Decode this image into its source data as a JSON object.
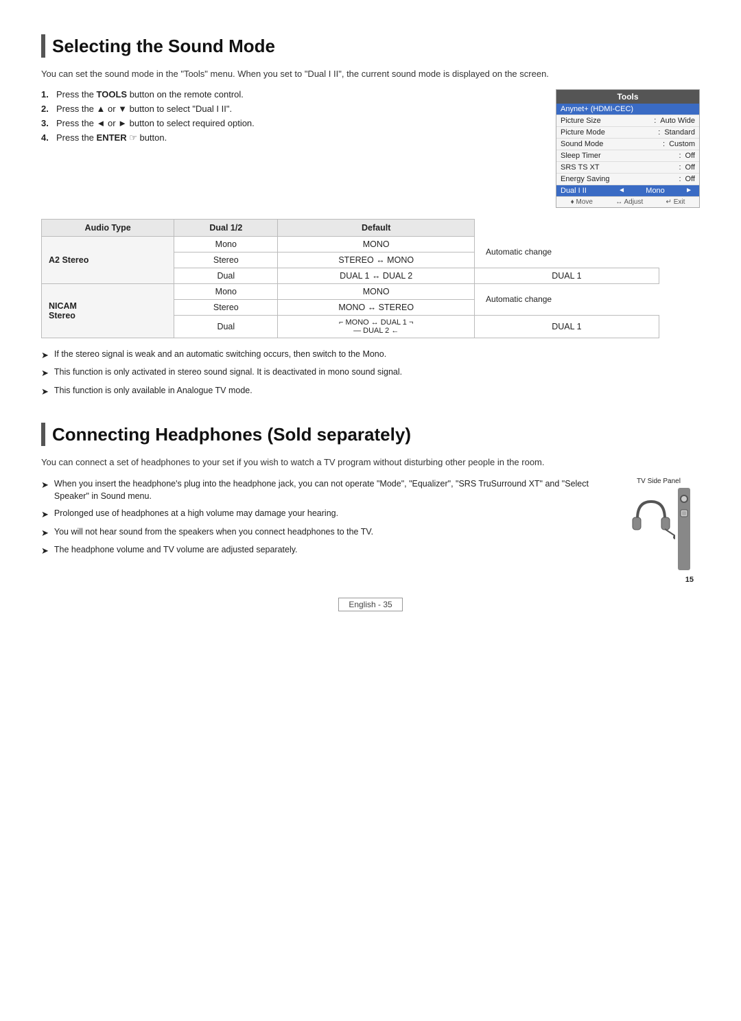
{
  "section1": {
    "title": "Selecting the Sound Mode",
    "intro": "You can set the sound mode in the \"Tools\" menu. When you set to \"Dual I II\", the current sound mode is displayed on the screen.",
    "steps": [
      {
        "num": "1.",
        "text": "Press the ",
        "bold": "TOOLS",
        "rest": " button on the remote control."
      },
      {
        "num": "2.",
        "text": "Press the ▲ or ▼ button to select \"Dual I II\"."
      },
      {
        "num": "3.",
        "text": "Press the ◄ or ► button to select required option."
      },
      {
        "num": "4.",
        "text": "Press the ",
        "bold": "ENTER",
        "rest": " ☞ button."
      }
    ],
    "tools_menu": {
      "title": "Tools",
      "rows": [
        {
          "label": "Anynet+ (HDMI-CEC)",
          "value": "",
          "highlighted": true
        },
        {
          "label": "Picture Size",
          "colon": ":",
          "value": "Auto Wide"
        },
        {
          "label": "Picture Mode",
          "colon": ":",
          "value": "Standard"
        },
        {
          "label": "Sound Mode",
          "colon": ":",
          "value": "Custom"
        },
        {
          "label": "Sleep Timer",
          "colon": ":",
          "value": "Off"
        },
        {
          "label": "SRS TS XT",
          "colon": ":",
          "value": "Off"
        },
        {
          "label": "Energy Saving",
          "colon": ":",
          "value": "Off"
        }
      ],
      "nav_row": {
        "label": "Dual I II",
        "left_arrow": "◄",
        "value": "Mono",
        "right_arrow": "►"
      },
      "footer": [
        "♦ Move",
        "↔ Adjust",
        "↵ Exit"
      ]
    },
    "table": {
      "headers": [
        "Audio Type",
        "Dual 1/2",
        "Default"
      ],
      "groups": [
        {
          "type": "A2 Stereo",
          "rows": [
            {
              "audio": "Mono",
              "dual": "MONO",
              "default": "",
              "note": ""
            },
            {
              "audio": "Stereo",
              "dual": "STEREO ↔ MONO",
              "default": "",
              "note": "Automatic change"
            },
            {
              "audio": "Dual",
              "dual": "DUAL 1 ↔ DUAL 2",
              "default": "DUAL 1",
              "note": ""
            }
          ]
        },
        {
          "type": "NICAM Stereo",
          "rows": [
            {
              "audio": "Mono",
              "dual": "MONO",
              "default": "",
              "note": ""
            },
            {
              "audio": "Stereo",
              "dual": "MONO ↔ STEREO",
              "default": "",
              "note": "Automatic change"
            },
            {
              "audio": "Dual",
              "dual": "⌐ MONO ↔ DUAL 1 ¬\n— DUAL 2 ←",
              "default": "DUAL 1",
              "note": ""
            }
          ]
        }
      ]
    },
    "notes": [
      "If the stereo signal is weak and an automatic switching occurs, then switch to the Mono.",
      "This function is only activated in stereo sound signal. It is deactivated in mono sound signal.",
      "This function is only available in Analogue TV mode."
    ]
  },
  "section2": {
    "title": "Connecting Headphones (Sold separately)",
    "intro": "You can connect a set of headphones to your set if you wish to watch a TV program without disturbing other people in the room.",
    "bullets": [
      "When you insert the headphone's plug into the headphone jack, you can not operate \"Mode\", \"Equalizer\", \"SRS TruSurround XT\" and \"Select Speaker\" in Sound menu.",
      "Prolonged use of headphones at a high volume may damage your hearing.",
      "You will not hear sound from the speakers when you connect headphones to the TV.",
      "The headphone volume and TV volume are adjusted separately."
    ],
    "tv_side_label": "TV Side Panel",
    "tv_number": "15"
  },
  "footer": {
    "text": "English - 35"
  }
}
